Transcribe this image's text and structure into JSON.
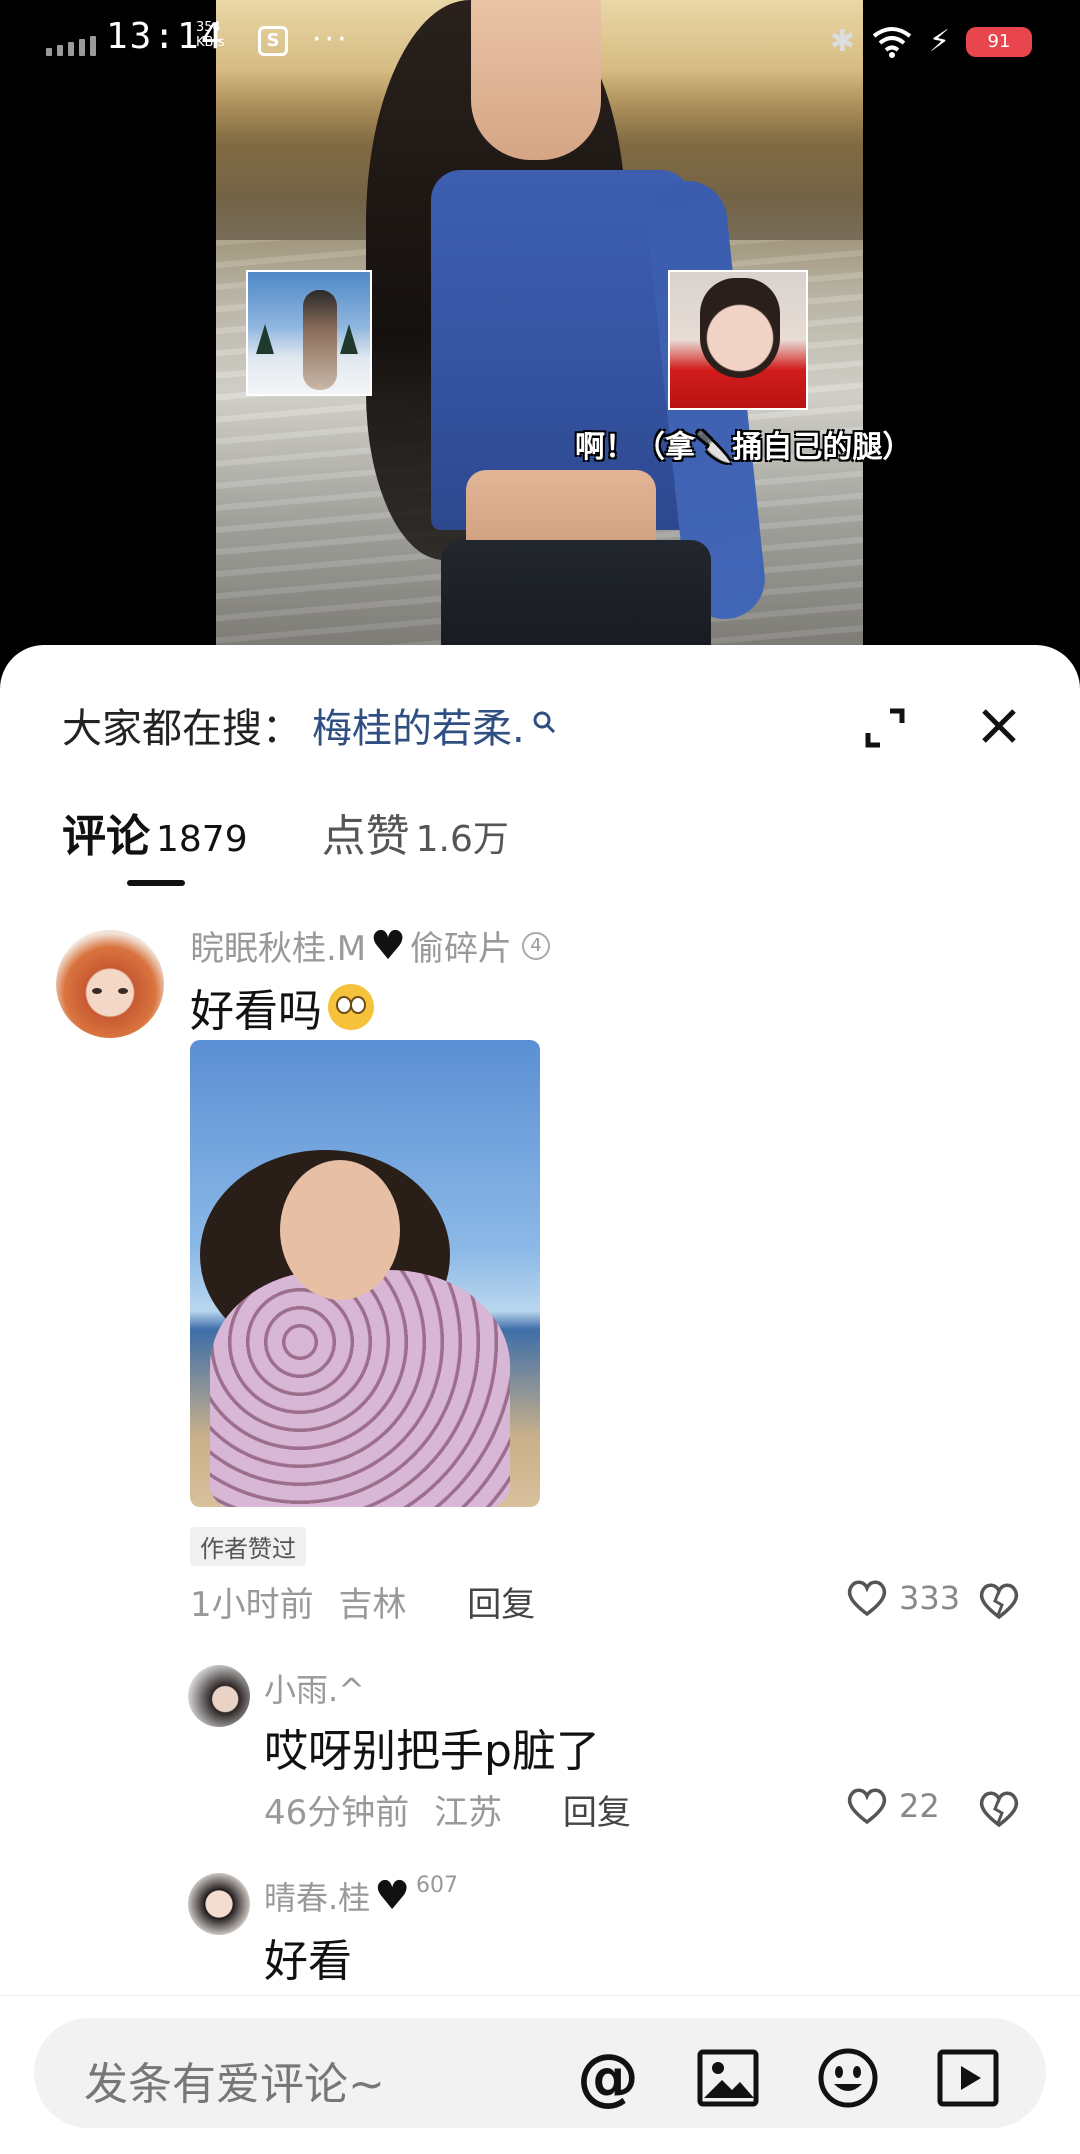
{
  "status_bar": {
    "time": "13:14",
    "net_speed_value": "354",
    "net_speed_unit": "KB/s",
    "app_icon_letter": "S",
    "more_dots": "···",
    "battery": "91"
  },
  "video": {
    "caption": "啊！（拿🔪捅自己的腿）"
  },
  "sheet": {
    "search_prefix": "大家都在搜：",
    "search_term": "梅桂的若柔.",
    "search_icon": "magnifier-icon"
  },
  "tabs": {
    "comments_label": "评论",
    "comments_count": "1879",
    "likes_label": "点赞",
    "likes_count": "1.6万"
  },
  "comments": [
    {
      "user_name_a": "睆眠秋桂.M",
      "user_name_b": "偷碎片",
      "badge": "4",
      "text": "好看吗",
      "author_liked": "作者赞过",
      "time": "1小时前",
      "location": "吉林",
      "reply": "回复",
      "likes": "333"
    }
  ],
  "replies": [
    {
      "user_name": "小雨.^",
      "text": "哎呀别把手p脏了",
      "time": "46分钟前",
      "location": "江苏",
      "reply": "回复",
      "likes": "22"
    },
    {
      "user_name": "晴春.桂",
      "suffix": "607",
      "text": "好看"
    }
  ],
  "input": {
    "placeholder": "发条有爱评论~",
    "at_symbol": "@"
  }
}
